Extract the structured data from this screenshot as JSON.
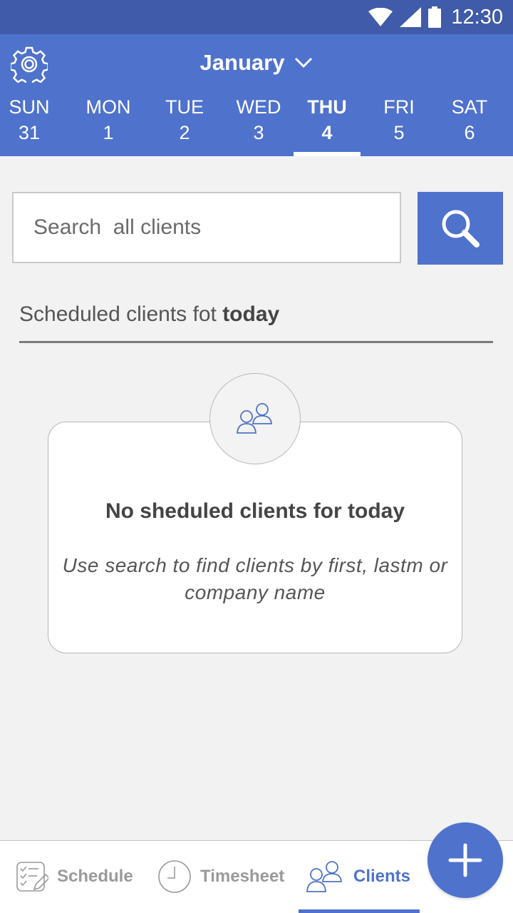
{
  "status_bar": {
    "time": "12:30"
  },
  "header": {
    "month": "January",
    "days": [
      {
        "name": "SUN",
        "num": "31"
      },
      {
        "name": "MON",
        "num": "1"
      },
      {
        "name": "TUE",
        "num": "2"
      },
      {
        "name": "WED",
        "num": "3"
      },
      {
        "name": "THU",
        "num": "4"
      },
      {
        "name": "FRI",
        "num": "5"
      },
      {
        "name": "SAT",
        "num": "6"
      }
    ],
    "selected_day": "THU"
  },
  "search": {
    "placeholder": "Search  all clients"
  },
  "section": {
    "prefix": "Scheduled clients fot ",
    "emphasis": "today"
  },
  "empty_state": {
    "title": "No sheduled clients for today",
    "description": "Use search to find clients by first, lastm or company name"
  },
  "bottom_nav": {
    "items": [
      {
        "label": "Schedule",
        "icon": "checklist-edit-icon"
      },
      {
        "label": "Timesheet",
        "icon": "clock-icon"
      },
      {
        "label": "Clients",
        "icon": "users-icon"
      }
    ],
    "active": "Clients"
  },
  "fab": {
    "icon": "plus-icon"
  },
  "colors": {
    "primary": "#4f72cc",
    "status_bar": "#3f5ba9",
    "background": "#f2f2f2"
  }
}
